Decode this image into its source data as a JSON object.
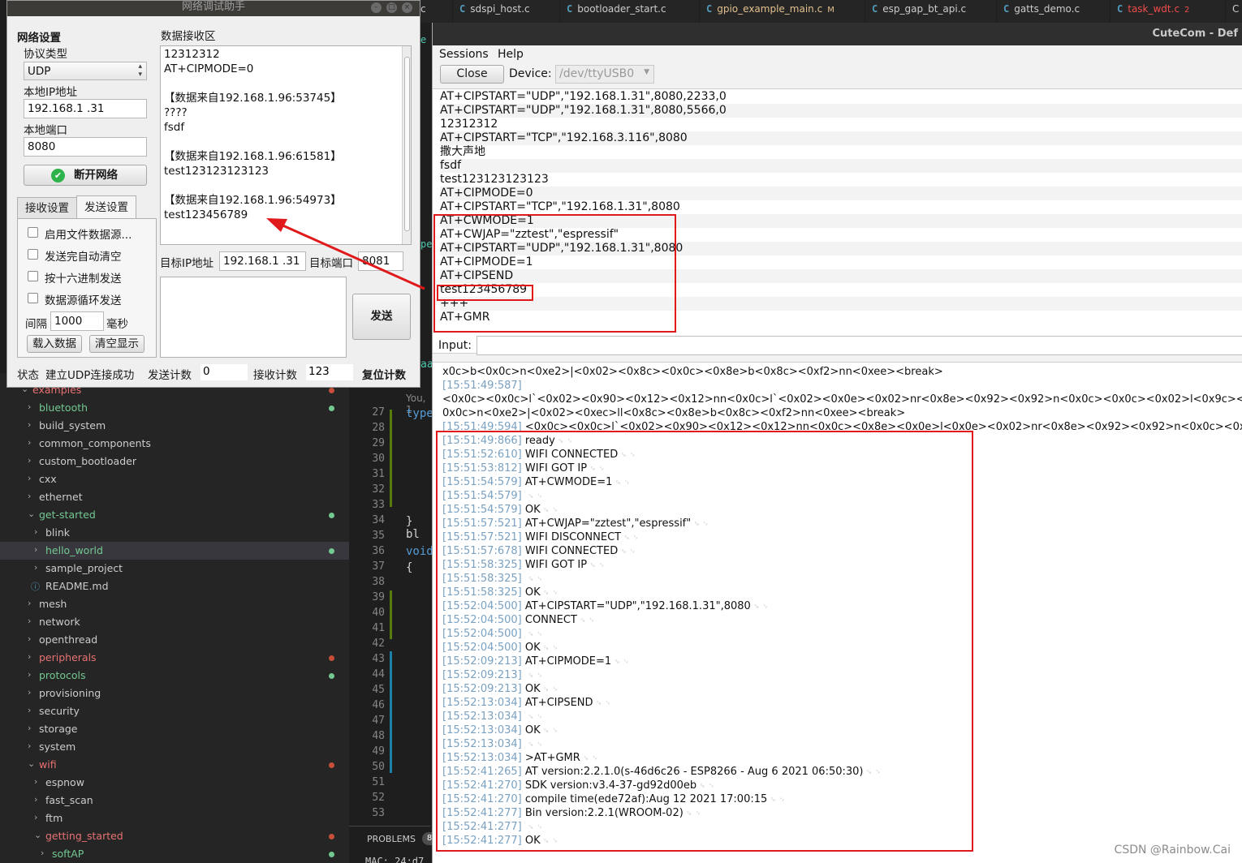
{
  "vscode": {
    "tabs": [
      {
        "label": "c",
        "color": "plain"
      },
      {
        "label": "sdspi_host.c",
        "color": "plain"
      },
      {
        "label": "bootloader_start.c",
        "color": "plain"
      },
      {
        "label": "gpio_example_main.c",
        "badge": "M",
        "color": "modified"
      },
      {
        "label": "esp_gap_bt_api.c",
        "color": "plain"
      },
      {
        "label": "gatts_demo.c",
        "color": "plain"
      },
      {
        "label": "task_wdt.c",
        "badge": "2",
        "color": "error"
      },
      {
        "label": "C",
        "color": "plain"
      }
    ],
    "file_icon": "C",
    "explorer": [
      {
        "label": "examples",
        "indent": 0,
        "chevron": "open",
        "state": "error",
        "dot": true
      },
      {
        "label": "bluetooth",
        "indent": 1,
        "chevron": "closed",
        "state": "green",
        "dot": true
      },
      {
        "label": "build_system",
        "indent": 1,
        "chevron": "closed",
        "state": "plain"
      },
      {
        "label": "common_components",
        "indent": 1,
        "chevron": "closed",
        "state": "plain"
      },
      {
        "label": "custom_bootloader",
        "indent": 1,
        "chevron": "closed",
        "state": "plain"
      },
      {
        "label": "cxx",
        "indent": 1,
        "chevron": "closed",
        "state": "plain"
      },
      {
        "label": "ethernet",
        "indent": 1,
        "chevron": "closed",
        "state": "plain"
      },
      {
        "label": "get-started",
        "indent": 1,
        "chevron": "open",
        "state": "green",
        "dot": true
      },
      {
        "label": "blink",
        "indent": 2,
        "chevron": "closed",
        "state": "plain"
      },
      {
        "label": "hello_world",
        "indent": 2,
        "chevron": "closed",
        "state": "green",
        "dot": true,
        "selected": true
      },
      {
        "label": "sample_project",
        "indent": 2,
        "chevron": "closed",
        "state": "plain"
      },
      {
        "label": "README.md",
        "indent": 2,
        "chevron": "info",
        "state": "plain"
      },
      {
        "label": "mesh",
        "indent": 1,
        "chevron": "closed",
        "state": "plain"
      },
      {
        "label": "network",
        "indent": 1,
        "chevron": "closed",
        "state": "plain"
      },
      {
        "label": "openthread",
        "indent": 1,
        "chevron": "closed",
        "state": "plain"
      },
      {
        "label": "peripherals",
        "indent": 1,
        "chevron": "closed",
        "state": "error",
        "dot": true
      },
      {
        "label": "protocols",
        "indent": 1,
        "chevron": "closed",
        "state": "green",
        "dot": true
      },
      {
        "label": "provisioning",
        "indent": 1,
        "chevron": "closed",
        "state": "plain"
      },
      {
        "label": "security",
        "indent": 1,
        "chevron": "closed",
        "state": "plain"
      },
      {
        "label": "storage",
        "indent": 1,
        "chevron": "closed",
        "state": "plain"
      },
      {
        "label": "system",
        "indent": 1,
        "chevron": "closed",
        "state": "plain"
      },
      {
        "label": "wifi",
        "indent": 1,
        "chevron": "open",
        "state": "error",
        "dot": true
      },
      {
        "label": "espnow",
        "indent": 2,
        "chevron": "closed",
        "state": "plain"
      },
      {
        "label": "fast_scan",
        "indent": 2,
        "chevron": "closed",
        "state": "plain"
      },
      {
        "label": "ftm",
        "indent": 2,
        "chevron": "closed",
        "state": "plain"
      },
      {
        "label": "getting_started",
        "indent": 2,
        "chevron": "open",
        "state": "error",
        "dot": true
      },
      {
        "label": "softAP",
        "indent": 3,
        "chevron": "closed",
        "state": "green",
        "dot": true
      }
    ],
    "line_numbers": [
      "27",
      "28",
      "29",
      "30",
      "31",
      "32",
      "33",
      "34",
      "35",
      "36",
      "37",
      "38",
      "39",
      "40",
      "41",
      "42",
      "43",
      "44",
      "45",
      "46",
      "47",
      "48",
      "49",
      "50",
      "51",
      "52",
      "53"
    ],
    "code_fragments": {
      "you": "You, 1",
      "type": "type",
      "brace": "} bl",
      "void": "void",
      "open": "{",
      "aa": "aa",
      "e": "e",
      "pe": "pe"
    },
    "problems_label": "PROBLEMS",
    "problems_count": "8",
    "mac_text": "MAC: 24:d7"
  },
  "nettool": {
    "title": "网络调试助手",
    "section_title": "网络设置",
    "protocol_label": "协议类型",
    "protocol_value": "UDP",
    "local_ip_label": "本地IP地址",
    "local_ip_value": "192.168.1 .31",
    "local_port_label": "本地端口",
    "local_port_value": "8080",
    "disconnect_button": "断开网络",
    "tab_receive": "接收设置",
    "tab_send": "发送设置",
    "options": [
      "启用文件数据源...",
      "发送完自动清空",
      "按十六进制发送",
      "数据源循环发送"
    ],
    "interval_label": "间隔",
    "interval_value": "1000",
    "interval_unit": "毫秒",
    "load_data_button": "载入数据",
    "clear_display_button": "清空显示",
    "receive_area_label": "数据接收区",
    "receive_lines": [
      "12312312",
      "AT+CIPMODE=0",
      "",
      "【数据来自192.168.1.96:53745】",
      "????",
      "fsdf",
      "",
      "【数据来自192.168.1.96:61581】",
      "test123123123123",
      "",
      "【数据来自192.168.1.96:54973】",
      "test123456789"
    ],
    "target_ip_label": "目标IP地址",
    "target_ip_value": "192.168.1 .31",
    "target_port_label": "目标端口",
    "target_port_value": "8081",
    "send_button": "发送",
    "status_label": "状态",
    "status_text": "建立UDP连接成功",
    "send_count_label": "发送计数",
    "send_count_value": "0",
    "recv_count_label": "接收计数",
    "recv_count_value": "123",
    "reset_count_button": "复位计数"
  },
  "cutecom": {
    "title": "CuteCom - Def",
    "menu_sessions": "Sessions",
    "menu_help": "Help",
    "close_button": "Close",
    "device_label": "Device:",
    "device_value": "/dev/ttyUSB0",
    "history": [
      "AT+CIPSTART=\"UDP\",\"192.168.1.31\",8080,2233,0",
      "AT+CIPSTART=\"UDP\",\"192.168.1.31\",8080,5566,0",
      "12312312",
      "AT+CIPSTART=\"TCP\",\"192.168.3.116\",8080",
      "撒大声地",
      "fsdf",
      "test123123123123",
      "AT+CIPMODE=0",
      "AT+CIPSTART=\"TCP\",\"192.168.1.31\",8080",
      "AT+CWMODE=1",
      "AT+CWJAP=\"zztest\",\"espressif\"",
      "AT+CIPSTART=\"UDP\",\"192.168.1.31\",8080",
      "AT+CIPMODE=1",
      "AT+CIPSEND",
      "test123456789",
      "+++",
      "AT+GMR"
    ],
    "input_label": "Input:",
    "raw_lines": [
      {
        "ts": "",
        "text": "x0c>b<0x0c>n<0xe2>|<0x02><0x8c><0x0c><0x8e>b<0x8c><0xf2>nn<0xee><break>"
      },
      {
        "ts": "[15:51:49:587]",
        "text": ""
      },
      {
        "ts": "",
        "text": "<0x0c><0x0c>l`<0x02><0x90><0x12><0x12>nn<0x0c>l`<0x02><0x0e><0x02>nr<0x8e><0x92><0x92>n<0x0c><0x0c><0x02>l<0x9c><"
      },
      {
        "ts": "",
        "text": "0x0c>n<0xe2>|<0x02><0xec>ll<0x8c><0x8e>b<0x8c><0xf2>nn<0xee><break>"
      },
      {
        "ts": "[15:51:49:594]",
        "text": "<0x0c><0x0c>l`<0x02><0x90><0x12><0x12>nn<0x0c><0x8e><0x0e>l<0x0e><0x02>nr<0x8e><0x92><0x92>n<0x0c><0x"
      }
    ],
    "log": [
      {
        "ts": "[15:51:49:866]",
        "text": "ready"
      },
      {
        "ts": "[15:51:52:610]",
        "text": "WIFI CONNECTED"
      },
      {
        "ts": "[15:51:53:812]",
        "text": "WIFI GOT IP"
      },
      {
        "ts": "[15:51:54:579]",
        "text": "AT+CWMODE=1"
      },
      {
        "ts": "[15:51:54:579]",
        "text": ""
      },
      {
        "ts": "[15:51:54:579]",
        "text": "OK"
      },
      {
        "ts": "[15:51:57:521]",
        "text": "AT+CWJAP=\"zztest\",\"espressif\""
      },
      {
        "ts": "[15:51:57:521]",
        "text": "WIFI DISCONNECT"
      },
      {
        "ts": "[15:51:57:678]",
        "text": "WIFI CONNECTED"
      },
      {
        "ts": "[15:51:58:325]",
        "text": "WIFI GOT IP"
      },
      {
        "ts": "[15:51:58:325]",
        "text": ""
      },
      {
        "ts": "[15:51:58:325]",
        "text": "OK"
      },
      {
        "ts": "[15:52:04:500]",
        "text": "AT+CIPSTART=\"UDP\",\"192.168.1.31\",8080"
      },
      {
        "ts": "[15:52:04:500]",
        "text": "CONNECT"
      },
      {
        "ts": "[15:52:04:500]",
        "text": ""
      },
      {
        "ts": "[15:52:04:500]",
        "text": "OK"
      },
      {
        "ts": "[15:52:09:213]",
        "text": "AT+CIPMODE=1"
      },
      {
        "ts": "[15:52:09:213]",
        "text": ""
      },
      {
        "ts": "[15:52:09:213]",
        "text": "OK"
      },
      {
        "ts": "[15:52:13:034]",
        "text": "AT+CIPSEND"
      },
      {
        "ts": "[15:52:13:034]",
        "text": ""
      },
      {
        "ts": "[15:52:13:034]",
        "text": "OK"
      },
      {
        "ts": "[15:52:13:034]",
        "text": ""
      },
      {
        "ts": "[15:52:13:034]",
        "text": ">AT+GMR"
      },
      {
        "ts": "[15:52:41:265]",
        "text": "AT version:2.2.1.0(s-46d6c26 - ESP8266 - Aug  6 2021 06:50:30)"
      },
      {
        "ts": "[15:52:41:270]",
        "text": "SDK version:v3.4-37-gd92d00eb"
      },
      {
        "ts": "[15:52:41:270]",
        "text": "compile time(ede72af):Aug 12 2021 17:00:15"
      },
      {
        "ts": "[15:52:41:277]",
        "text": "Bin version:2.2.1(WROOM-02)"
      },
      {
        "ts": "[15:52:41:277]",
        "text": ""
      },
      {
        "ts": "[15:52:41:277]",
        "text": "OK"
      }
    ],
    "line_end_symbol": "␍ ␊"
  },
  "watermark": "CSDN @Rainbow.Cai",
  "colors": {
    "annotation_red": "#e0191b",
    "timestamp": "#7aa1c2",
    "tab_error": "#f14c4c",
    "tab_modified": "#e2c08d",
    "tree_green": "#73c991"
  }
}
